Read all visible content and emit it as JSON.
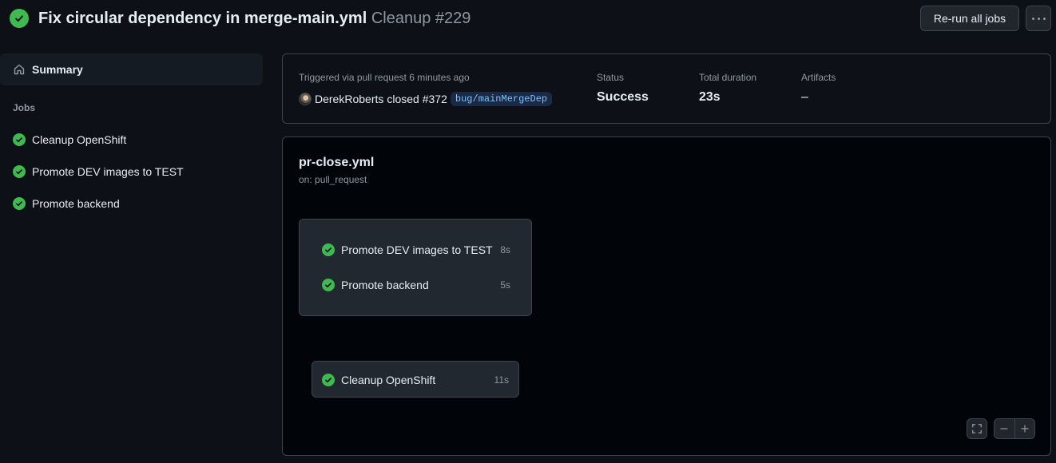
{
  "header": {
    "title": "Fix circular dependency in merge-main.yml",
    "run_label": "Cleanup #229",
    "rerun_label": "Re-run all jobs"
  },
  "sidebar": {
    "summary_label": "Summary",
    "jobs_heading": "Jobs",
    "jobs": [
      {
        "label": "Cleanup OpenShift",
        "status": "success"
      },
      {
        "label": "Promote DEV images to TEST",
        "status": "success"
      },
      {
        "label": "Promote backend",
        "status": "success"
      }
    ]
  },
  "run_info": {
    "triggered": "Triggered via pull request 6 minutes ago",
    "actor": "DerekRoberts",
    "action_text": "closed #372",
    "branch": "bug/mainMergeDep",
    "status_label": "Status",
    "status_value": "Success",
    "duration_label": "Total duration",
    "duration_value": "23s",
    "artifacts_label": "Artifacts",
    "artifacts_value": "–"
  },
  "workflow": {
    "name": "pr-close.yml",
    "trigger": "on: pull_request",
    "group_jobs": [
      {
        "label": "Promote DEV images to TEST",
        "duration": "8s"
      },
      {
        "label": "Promote backend",
        "duration": "5s"
      }
    ],
    "single_job": {
      "label": "Cleanup OpenShift",
      "duration": "11s"
    }
  },
  "colors": {
    "success": "#3fb950",
    "background": "#0d1117",
    "branch_bg": "#1a2a44",
    "branch_text": "#79c0ff"
  }
}
